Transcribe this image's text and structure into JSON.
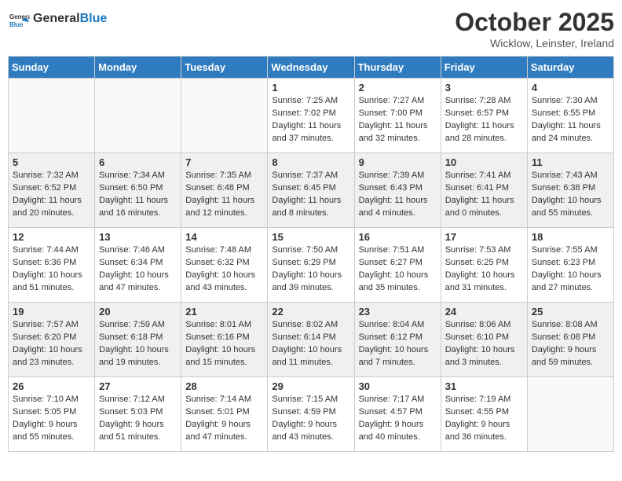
{
  "header": {
    "logo": {
      "general": "General",
      "blue": "Blue"
    },
    "title": "October 2025",
    "location": "Wicklow, Leinster, Ireland"
  },
  "weekdays": [
    "Sunday",
    "Monday",
    "Tuesday",
    "Wednesday",
    "Thursday",
    "Friday",
    "Saturday"
  ],
  "weeks": [
    {
      "shade": "white",
      "days": [
        {
          "num": "",
          "info": ""
        },
        {
          "num": "",
          "info": ""
        },
        {
          "num": "",
          "info": ""
        },
        {
          "num": "1",
          "info": "Sunrise: 7:25 AM\nSunset: 7:02 PM\nDaylight: 11 hours\nand 37 minutes."
        },
        {
          "num": "2",
          "info": "Sunrise: 7:27 AM\nSunset: 7:00 PM\nDaylight: 11 hours\nand 32 minutes."
        },
        {
          "num": "3",
          "info": "Sunrise: 7:28 AM\nSunset: 6:57 PM\nDaylight: 11 hours\nand 28 minutes."
        },
        {
          "num": "4",
          "info": "Sunrise: 7:30 AM\nSunset: 6:55 PM\nDaylight: 11 hours\nand 24 minutes."
        }
      ]
    },
    {
      "shade": "shaded",
      "days": [
        {
          "num": "5",
          "info": "Sunrise: 7:32 AM\nSunset: 6:52 PM\nDaylight: 11 hours\nand 20 minutes."
        },
        {
          "num": "6",
          "info": "Sunrise: 7:34 AM\nSunset: 6:50 PM\nDaylight: 11 hours\nand 16 minutes."
        },
        {
          "num": "7",
          "info": "Sunrise: 7:35 AM\nSunset: 6:48 PM\nDaylight: 11 hours\nand 12 minutes."
        },
        {
          "num": "8",
          "info": "Sunrise: 7:37 AM\nSunset: 6:45 PM\nDaylight: 11 hours\nand 8 minutes."
        },
        {
          "num": "9",
          "info": "Sunrise: 7:39 AM\nSunset: 6:43 PM\nDaylight: 11 hours\nand 4 minutes."
        },
        {
          "num": "10",
          "info": "Sunrise: 7:41 AM\nSunset: 6:41 PM\nDaylight: 11 hours\nand 0 minutes."
        },
        {
          "num": "11",
          "info": "Sunrise: 7:43 AM\nSunset: 6:38 PM\nDaylight: 10 hours\nand 55 minutes."
        }
      ]
    },
    {
      "shade": "white",
      "days": [
        {
          "num": "12",
          "info": "Sunrise: 7:44 AM\nSunset: 6:36 PM\nDaylight: 10 hours\nand 51 minutes."
        },
        {
          "num": "13",
          "info": "Sunrise: 7:46 AM\nSunset: 6:34 PM\nDaylight: 10 hours\nand 47 minutes."
        },
        {
          "num": "14",
          "info": "Sunrise: 7:48 AM\nSunset: 6:32 PM\nDaylight: 10 hours\nand 43 minutes."
        },
        {
          "num": "15",
          "info": "Sunrise: 7:50 AM\nSunset: 6:29 PM\nDaylight: 10 hours\nand 39 minutes."
        },
        {
          "num": "16",
          "info": "Sunrise: 7:51 AM\nSunset: 6:27 PM\nDaylight: 10 hours\nand 35 minutes."
        },
        {
          "num": "17",
          "info": "Sunrise: 7:53 AM\nSunset: 6:25 PM\nDaylight: 10 hours\nand 31 minutes."
        },
        {
          "num": "18",
          "info": "Sunrise: 7:55 AM\nSunset: 6:23 PM\nDaylight: 10 hours\nand 27 minutes."
        }
      ]
    },
    {
      "shade": "shaded",
      "days": [
        {
          "num": "19",
          "info": "Sunrise: 7:57 AM\nSunset: 6:20 PM\nDaylight: 10 hours\nand 23 minutes."
        },
        {
          "num": "20",
          "info": "Sunrise: 7:59 AM\nSunset: 6:18 PM\nDaylight: 10 hours\nand 19 minutes."
        },
        {
          "num": "21",
          "info": "Sunrise: 8:01 AM\nSunset: 6:16 PM\nDaylight: 10 hours\nand 15 minutes."
        },
        {
          "num": "22",
          "info": "Sunrise: 8:02 AM\nSunset: 6:14 PM\nDaylight: 10 hours\nand 11 minutes."
        },
        {
          "num": "23",
          "info": "Sunrise: 8:04 AM\nSunset: 6:12 PM\nDaylight: 10 hours\nand 7 minutes."
        },
        {
          "num": "24",
          "info": "Sunrise: 8:06 AM\nSunset: 6:10 PM\nDaylight: 10 hours\nand 3 minutes."
        },
        {
          "num": "25",
          "info": "Sunrise: 8:08 AM\nSunset: 6:08 PM\nDaylight: 9 hours\nand 59 minutes."
        }
      ]
    },
    {
      "shade": "white",
      "days": [
        {
          "num": "26",
          "info": "Sunrise: 7:10 AM\nSunset: 5:05 PM\nDaylight: 9 hours\nand 55 minutes."
        },
        {
          "num": "27",
          "info": "Sunrise: 7:12 AM\nSunset: 5:03 PM\nDaylight: 9 hours\nand 51 minutes."
        },
        {
          "num": "28",
          "info": "Sunrise: 7:14 AM\nSunset: 5:01 PM\nDaylight: 9 hours\nand 47 minutes."
        },
        {
          "num": "29",
          "info": "Sunrise: 7:15 AM\nSunset: 4:59 PM\nDaylight: 9 hours\nand 43 minutes."
        },
        {
          "num": "30",
          "info": "Sunrise: 7:17 AM\nSunset: 4:57 PM\nDaylight: 9 hours\nand 40 minutes."
        },
        {
          "num": "31",
          "info": "Sunrise: 7:19 AM\nSunset: 4:55 PM\nDaylight: 9 hours\nand 36 minutes."
        },
        {
          "num": "",
          "info": ""
        }
      ]
    }
  ]
}
